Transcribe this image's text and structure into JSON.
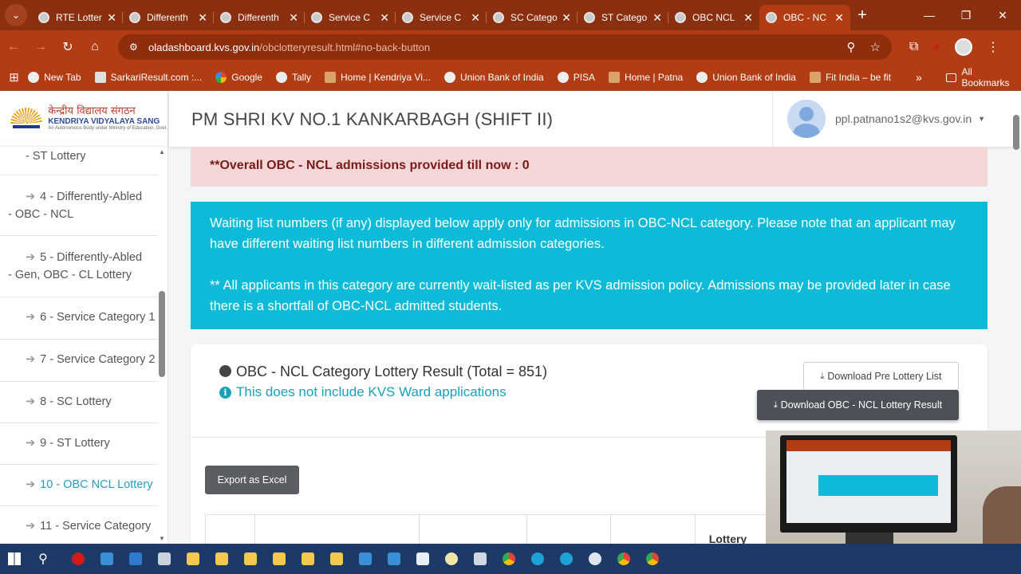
{
  "browser": {
    "tabs": [
      {
        "title": "RTE Lotter"
      },
      {
        "title": "Differenth"
      },
      {
        "title": "Differenth"
      },
      {
        "title": "Service C"
      },
      {
        "title": "Service C"
      },
      {
        "title": "SC Catego"
      },
      {
        "title": "ST Catego"
      },
      {
        "title": "OBC NCL"
      },
      {
        "title": "OBC - NC"
      }
    ],
    "url_domain": "oladashboard.kvs.gov.in",
    "url_path": "/obclotteryresult.html#no-back-button",
    "bookmarks": [
      {
        "label": "New Tab"
      },
      {
        "label": "SarkariResult.com :..."
      },
      {
        "label": "Google"
      },
      {
        "label": "Tally"
      },
      {
        "label": "Home | Kendriya Vi..."
      },
      {
        "label": "Union Bank of India"
      },
      {
        "label": "PISA"
      },
      {
        "label": "Home | Patna"
      },
      {
        "label": "Union Bank of India"
      },
      {
        "label": "Fit India – be fit"
      }
    ],
    "all_bookmarks": "All Bookmarks"
  },
  "logo": {
    "hindi": "केन्द्रीय विद्यालय संगठन",
    "english": "KENDRIYA VIDYALAYA SANG",
    "sub": "An Autonomous Body under Ministry of Education, Govt."
  },
  "sidebar": {
    "items": [
      {
        "line1": "- ST Lottery",
        "line2": ""
      },
      {
        "line1": "4 - Differently-Abled",
        "line2": "- OBC - NCL"
      },
      {
        "line1": "5 - Differently-Abled",
        "line2": "- Gen, OBC - CL Lottery"
      },
      {
        "line1": "6 - Service Category 1",
        "line2": ""
      },
      {
        "line1": "7 - Service Category 2",
        "line2": ""
      },
      {
        "line1": "8 - SC Lottery",
        "line2": ""
      },
      {
        "line1": "9 - ST Lottery",
        "line2": ""
      },
      {
        "line1": "10 - OBC NCL Lottery",
        "line2": ""
      },
      {
        "line1": "11 - Service Category",
        "line2": ""
      }
    ]
  },
  "header": {
    "school": "PM SHRI KV NO.1 KANKARBAGH (SHIFT II)",
    "email": "ppl.patnano1s2@kvs.gov.in"
  },
  "alerts": {
    "admissions": "**Overall OBC - NCL admissions provided till now : 0",
    "waiting_info": "Waiting list numbers (if any) displayed below apply only for admissions in OBC-NCL category. Please note that an applicant may have different waiting list numbers in different admission categories.",
    "policy": "** All applicants in this category are currently wait-listed as per KVS admission policy. Admissions may be provided later in case there is a shortfall of OBC-NCL admitted students."
  },
  "result_card": {
    "title": "OBC - NCL Category Lottery Result (Total = 851)",
    "note": "This does not include KVS Ward applications",
    "download_pre": "Download Pre Lottery List",
    "download_result": "Download OBC - NCL Lottery Result",
    "export": "Export as Excel",
    "table_headers": [
      "",
      "",
      "",
      "",
      "",
      "Lottery"
    ]
  }
}
